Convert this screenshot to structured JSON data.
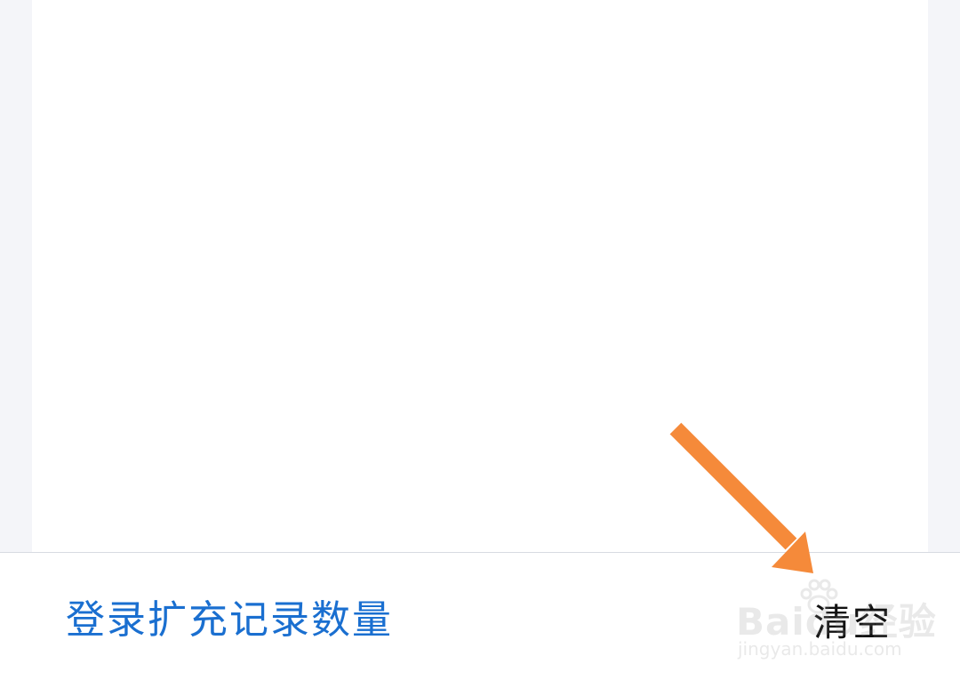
{
  "bottom_bar": {
    "login_label": "登录扩充记录数量",
    "clear_label": "清空"
  },
  "watermark": {
    "text": "Baidu经验",
    "url_text": "jingyan.baidu.com"
  },
  "colors": {
    "link": "#1a6fd0",
    "arrow": "#f58a3a",
    "background": "#f4f5f9"
  }
}
